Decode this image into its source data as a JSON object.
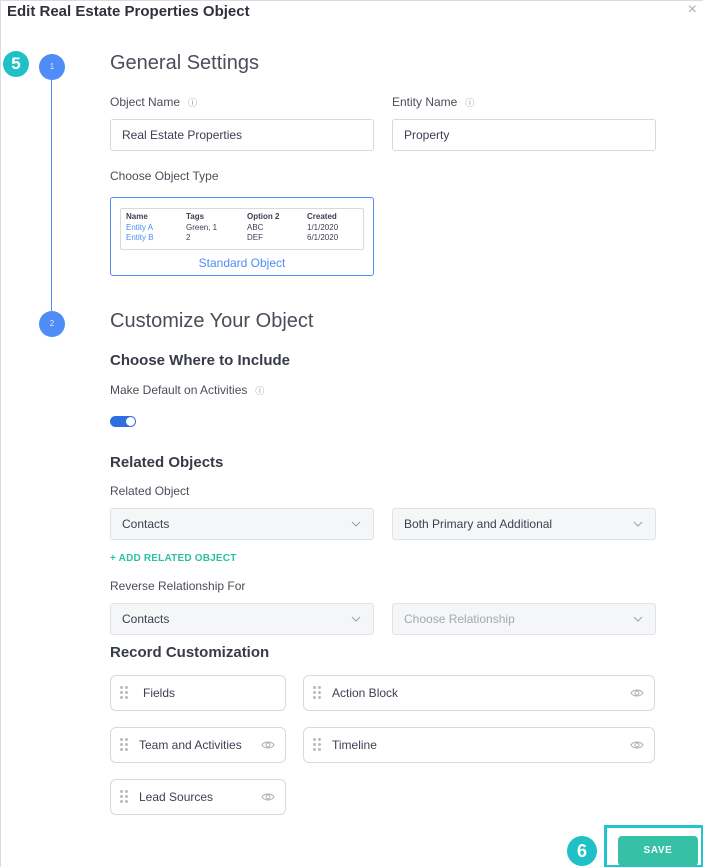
{
  "modal": {
    "title": "Edit Real Estate Properties Object",
    "close": "×"
  },
  "badges": {
    "step_5": "5",
    "step_6": "6"
  },
  "steps": [
    {
      "number": "1",
      "title": "General Settings"
    },
    {
      "number": "2",
      "title": "Customize Your Object"
    }
  ],
  "general": {
    "object_name_label": "Object Name",
    "object_name_value": "Real Estate Properties",
    "entity_name_label": "Entity Name",
    "entity_name_value": "Property",
    "object_type_label": "Choose Object Type",
    "object_type_card": {
      "columns": [
        "Name",
        "Tags",
        "Option 2",
        "Created"
      ],
      "rows": [
        [
          "Entity A",
          "Green, 1",
          "ABC",
          "1/1/2020"
        ],
        [
          "Entity B",
          "2",
          "DEF",
          "6/1/2020"
        ]
      ],
      "caption": "Standard Object"
    }
  },
  "customize": {
    "include_heading": "Choose Where to Include",
    "default_activities_label": "Make Default on Activities",
    "default_activities_on": true,
    "related_heading": "Related Objects",
    "related_object_label": "Related Object",
    "related_object_value": "Contacts",
    "related_scope_value": "Both Primary and Additional",
    "add_related_link": "+ ADD RELATED OBJECT",
    "reverse_label": "Reverse Relationship For",
    "reverse_object_value": "Contacts",
    "reverse_relationship_placeholder": "Choose Relationship",
    "record_heading": "Record Customization",
    "record_cards": [
      {
        "label": "Fields",
        "eye": false
      },
      {
        "label": "Action Block",
        "eye": true
      },
      {
        "label": "Team and Activities",
        "eye": true
      },
      {
        "label": "Timeline",
        "eye": true
      },
      {
        "label": "Lead Sources",
        "eye": true
      }
    ]
  },
  "footer": {
    "save_label": "SAVE"
  },
  "colors": {
    "accent_blue": "#4f8cf6",
    "badge_teal": "#1fc1c7",
    "save_green": "#36c1a7",
    "link_green": "#2fbfa6"
  },
  "icons": {
    "close": "close-icon",
    "info": "info-icon",
    "chevron": "chevron-down-icon",
    "grip": "drag-handle-icon",
    "eye": "eye-icon"
  }
}
